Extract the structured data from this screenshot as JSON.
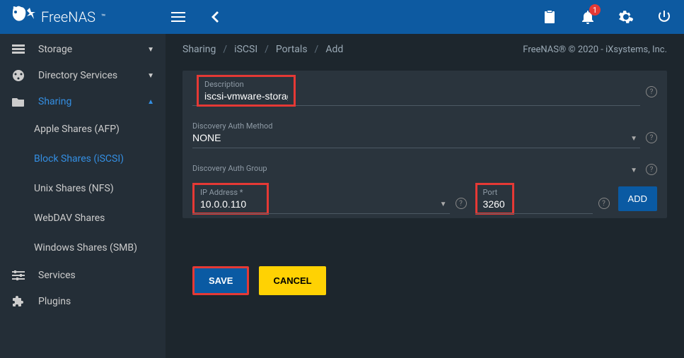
{
  "brand": "FreeNAS",
  "notification_count": "1",
  "sidebar": {
    "items": [
      {
        "label": "Storage"
      },
      {
        "label": "Directory Services"
      },
      {
        "label": "Sharing"
      },
      {
        "label": "Services"
      },
      {
        "label": "Plugins"
      }
    ],
    "sub": [
      {
        "label": "Apple Shares (AFP)"
      },
      {
        "label": "Block Shares (iSCSI)"
      },
      {
        "label": "Unix Shares (NFS)"
      },
      {
        "label": "WebDAV Shares"
      },
      {
        "label": "Windows Shares (SMB)"
      }
    ]
  },
  "breadcrumb": {
    "a": "Sharing",
    "b": "iSCSI",
    "c": "Portals",
    "d": "Add"
  },
  "copyright": "FreeNAS® © 2020 - iXsystems, Inc.",
  "form": {
    "desc_label": "Description",
    "desc_value": "iscsi-vmware-storage",
    "auth_method_label": "Discovery Auth Method",
    "auth_method_value": "NONE",
    "auth_group_label": "Discovery Auth Group",
    "ip_label": "IP Address *",
    "ip_value": "10.0.0.110",
    "port_label": "Port",
    "port_value": "3260",
    "add_btn": "ADD",
    "save": "SAVE",
    "cancel": "CANCEL"
  }
}
